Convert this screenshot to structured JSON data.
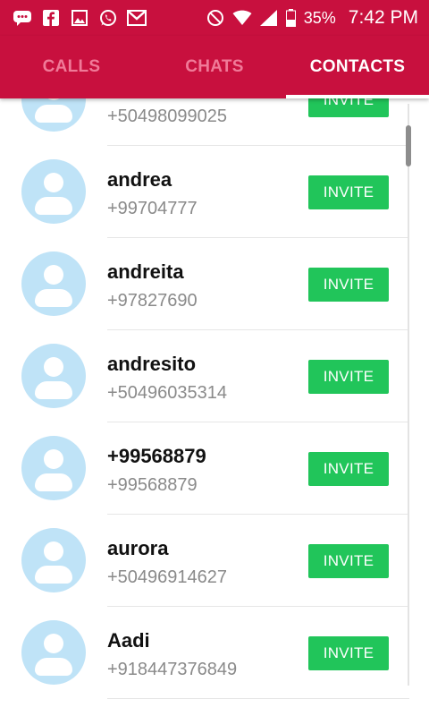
{
  "status_bar": {
    "battery": "35%",
    "time": "7:42 PM",
    "left_icons": [
      "chat-bubble-icon",
      "facebook-icon",
      "image-icon",
      "whatsapp-icon",
      "gmail-icon"
    ],
    "right_icons": [
      "do-not-disturb-icon",
      "wifi-icon",
      "signal-icon",
      "battery-icon"
    ]
  },
  "tabs": [
    {
      "label": "CALLS",
      "active": false
    },
    {
      "label": "CHATS",
      "active": false
    },
    {
      "label": "CONTACTS",
      "active": true
    }
  ],
  "colors": {
    "primary": "#c8103e",
    "invite": "#21c55a",
    "avatar_bg": "#bfe3f7"
  },
  "invite_label": "INVITE",
  "contacts": [
    {
      "name": "",
      "phone": "+50498099025"
    },
    {
      "name": "andrea",
      "phone": "+99704777"
    },
    {
      "name": "andreita",
      "phone": "+97827690"
    },
    {
      "name": "andresito",
      "phone": "+50496035314"
    },
    {
      "name": "+99568879",
      "phone": "+99568879"
    },
    {
      "name": "aurora",
      "phone": "+50496914627"
    },
    {
      "name": "Aadi",
      "phone": "+918447376849"
    }
  ]
}
